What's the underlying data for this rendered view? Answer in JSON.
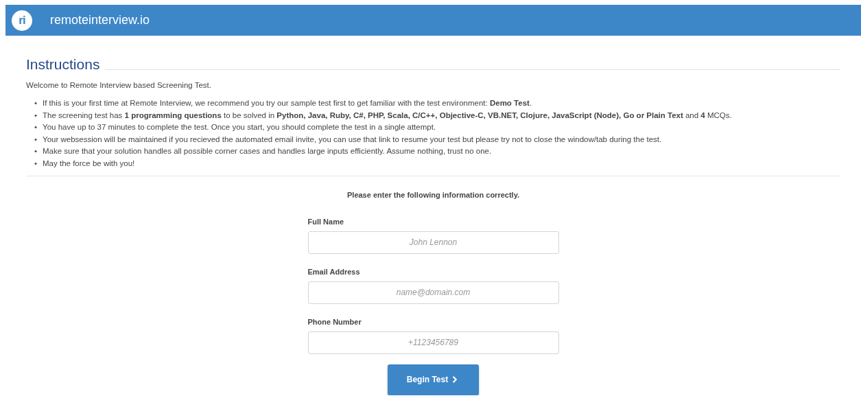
{
  "header": {
    "logo": "ri",
    "title": "remoteinterview.io"
  },
  "instructions": {
    "heading": "Instructions",
    "intro": "Welcome to Remote Interview based Screening Test.",
    "marker": "•",
    "bullets": [
      "If this is your first time at Remote Interview, we recommend you try our sample test first to get familiar with the test environment: **Demo Test**.",
      "The screening test has **1 programming questions** to be solved in **Python, Java, Ruby, C#, PHP, Scala, C/C++, Objective-C, VB.NET, Clojure, JavaScript (Node), Go or Plain Text** and **4** MCQs.",
      "You have up to 37 minutes to complete the test. Once you start, you should complete the test in a single attempt.",
      "Your websession will be maintained if you recieved the automated email invite, you can use that link to resume your test but please try not to close the window/tab during the test.",
      "Make sure that your solution handles all possible corner cases and handles large inputs efficiently. Assume nothing, trust no one.",
      "May the force be with you!"
    ]
  },
  "form": {
    "title": "Please enter the following information correctly.",
    "fields": [
      {
        "label": "Full Name",
        "placeholder": "John Lennon"
      },
      {
        "label": "Email Address",
        "placeholder": "name@domain.com"
      },
      {
        "label": "Phone Number",
        "placeholder": "+1123456789"
      }
    ],
    "button": "Begin Test"
  }
}
